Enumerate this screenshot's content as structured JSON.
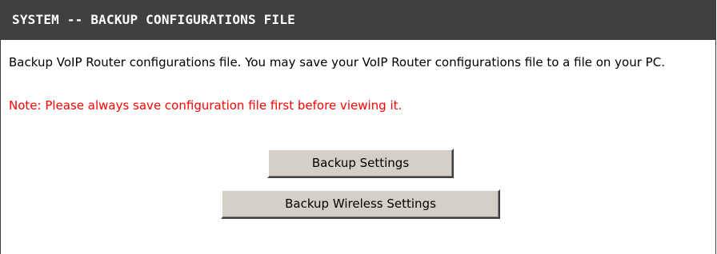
{
  "panel": {
    "title": "SYSTEM -- BACKUP CONFIGURATIONS FILE",
    "description": "Backup VoIP Router configurations file. You may save your VoIP Router configurations file to a file on your PC.",
    "note": "Note: Please always save configuration file first before viewing it."
  },
  "buttons": {
    "backup_settings": "Backup Settings",
    "backup_wireless_settings": "Backup Wireless Settings"
  },
  "colors": {
    "header_bg": "#404040",
    "header_text": "#ffffff",
    "note_text": "#ff0000",
    "button_face": "#d4d0c8"
  }
}
